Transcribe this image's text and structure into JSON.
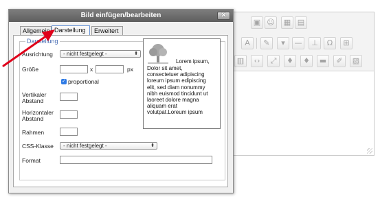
{
  "dialog": {
    "title": "Bild einfügen/bearbeiten",
    "close_symbol": "✕",
    "tabs": [
      {
        "label": "Allgemein"
      },
      {
        "label": "Darstellung"
      },
      {
        "label": "Erweitert"
      }
    ],
    "legend": "Darstellung",
    "fields": {
      "ausrichtung_label": "Ausrichtung",
      "ausrichtung_value": "- nicht festgelegt -",
      "groesse_label": "Größe",
      "times": "x",
      "unit": "px",
      "proportional_label": "proportional",
      "vertikaler_label_1": "Vertikaler",
      "vertikaler_label_2": "Abstand",
      "horizontaler_label_1": "Horizontaler",
      "horizontaler_label_2": "Abstand",
      "rahmen_label": "Rahmen",
      "css_label": "CSS-Klasse",
      "css_value": "- nicht festgelegt -",
      "format_label": "Format"
    },
    "preview": {
      "first_line": "Lorem ipsum,",
      "lines": [
        "Dolor sit amet,",
        "consectetuer adipiscing",
        "loreum ipsum edipiscing",
        "elit, sed diam nonummy",
        "nibh euismod tincidunt ut",
        "laoreet dolore magna",
        "aliquam erat",
        "volutpat.Loreum ipsum"
      ]
    }
  },
  "colors": {
    "annotation_arrow": "#e0001a",
    "tab_highlight": "#6a95d6",
    "legend": "#4a6fb5"
  },
  "editor_toolbar_icons": [
    "image-icon",
    "emoticon-icon",
    "table-icon",
    "paste-icon",
    "font-icon",
    "highlight-icon",
    "horizontal-rule-icon",
    "anchor-icon",
    "omega-icon",
    "grid-icon",
    "paste-text-icon",
    "code-icon",
    "fullscreen-icon",
    "microphone-icon",
    "spellcheck-icon",
    "print-icon",
    "pencil-icon",
    "media-icon"
  ]
}
